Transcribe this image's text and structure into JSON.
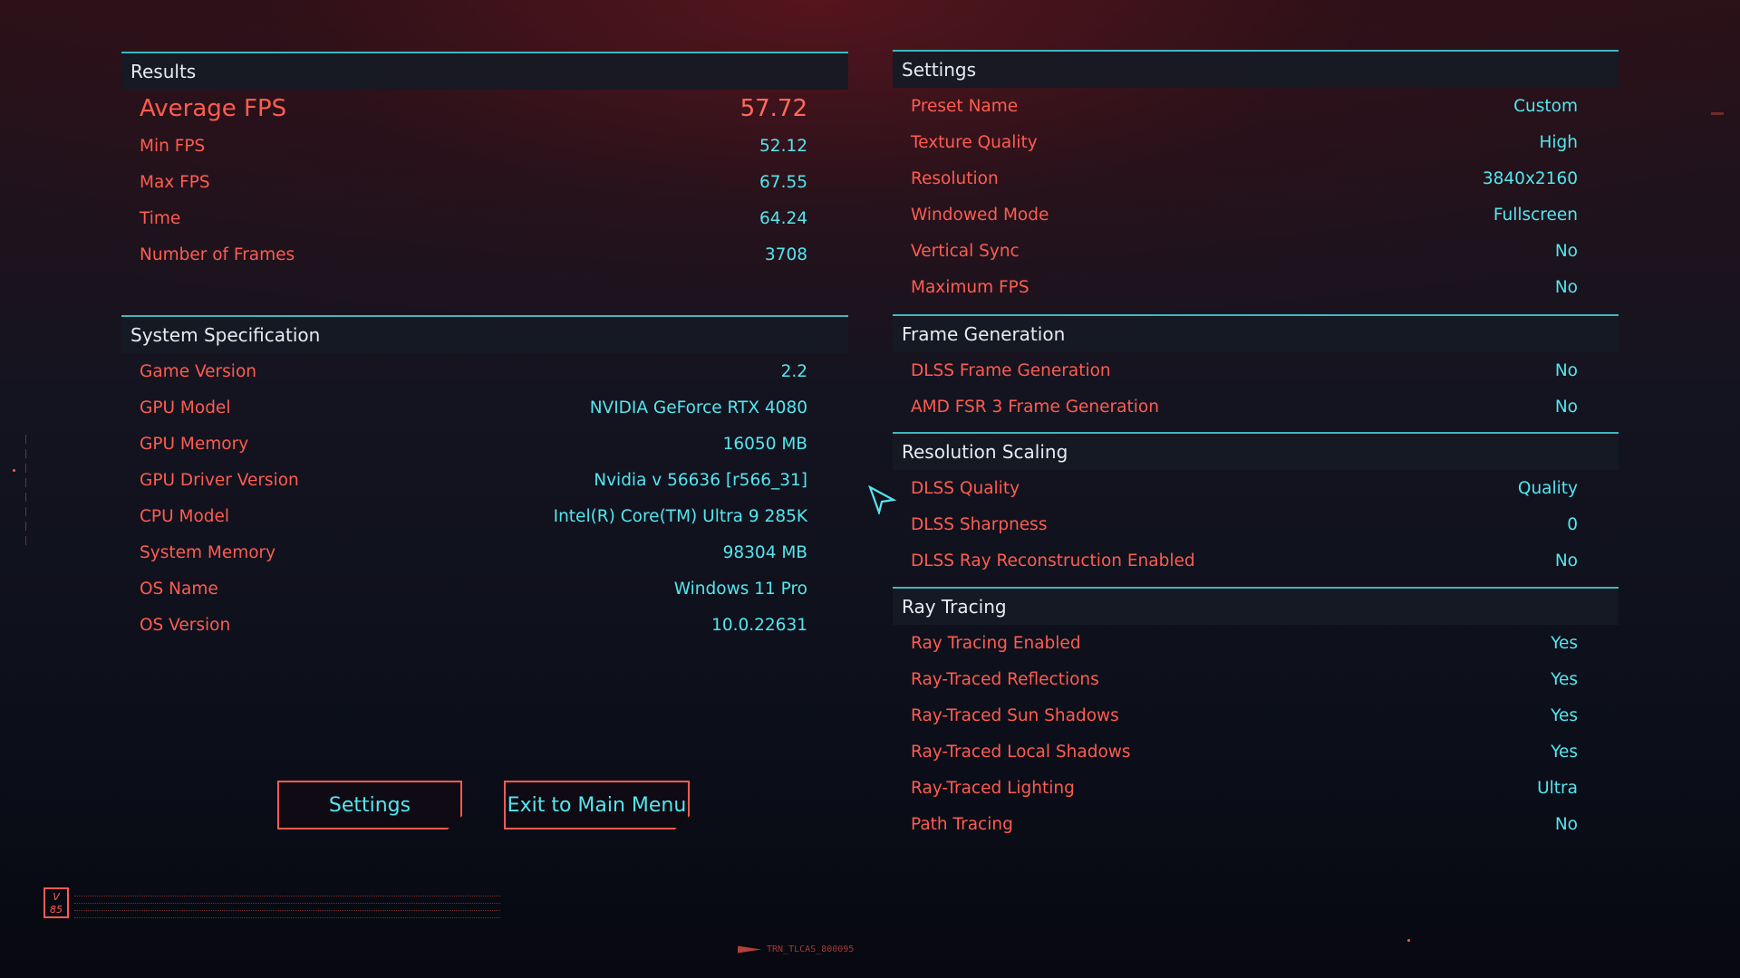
{
  "colors": {
    "label": "#ff5c50",
    "value": "#54e6ee",
    "header_text": "#e6ecf0",
    "accent_line": "#3fb7c0"
  },
  "results": {
    "header": "Results",
    "average_fps": {
      "label": "Average FPS",
      "value": "57.72"
    },
    "rows": [
      {
        "label": "Min FPS",
        "value": "52.12"
      },
      {
        "label": "Max FPS",
        "value": "67.55"
      },
      {
        "label": "Time",
        "value": "64.24"
      },
      {
        "label": "Number of Frames",
        "value": "3708"
      }
    ]
  },
  "system_spec": {
    "header": "System Specification",
    "rows": [
      {
        "label": "Game Version",
        "value": "2.2"
      },
      {
        "label": "GPU Model",
        "value": "NVIDIA GeForce RTX 4080"
      },
      {
        "label": "GPU Memory",
        "value": "16050 MB"
      },
      {
        "label": "GPU Driver Version",
        "value": "Nvidia v 56636 [r566_31]"
      },
      {
        "label": "CPU Model",
        "value": "Intel(R) Core(TM) Ultra 9 285K"
      },
      {
        "label": "System Memory",
        "value": "98304 MB"
      },
      {
        "label": "OS Name",
        "value": "Windows 11 Pro"
      },
      {
        "label": "OS Version",
        "value": "10.0.22631"
      }
    ]
  },
  "settings": {
    "header": "Settings",
    "rows": [
      {
        "label": "Preset Name",
        "value": "Custom"
      },
      {
        "label": "Texture Quality",
        "value": "High"
      },
      {
        "label": "Resolution",
        "value": "3840x2160"
      },
      {
        "label": "Windowed Mode",
        "value": "Fullscreen"
      },
      {
        "label": "Vertical Sync",
        "value": "No"
      },
      {
        "label": "Maximum FPS",
        "value": "No"
      }
    ]
  },
  "frame_generation": {
    "header": "Frame Generation",
    "rows": [
      {
        "label": "DLSS Frame Generation",
        "value": "No"
      },
      {
        "label": "AMD FSR 3 Frame Generation",
        "value": "No"
      }
    ]
  },
  "resolution_scaling": {
    "header": "Resolution Scaling",
    "rows": [
      {
        "label": "DLSS Quality",
        "value": "Quality"
      },
      {
        "label": "DLSS Sharpness",
        "value": "0"
      },
      {
        "label": "DLSS Ray Reconstruction Enabled",
        "value": "No"
      }
    ]
  },
  "ray_tracing": {
    "header": "Ray Tracing",
    "rows": [
      {
        "label": "Ray Tracing Enabled",
        "value": "Yes"
      },
      {
        "label": "Ray-Traced Reflections",
        "value": "Yes"
      },
      {
        "label": "Ray-Traced Sun Shadows",
        "value": "Yes"
      },
      {
        "label": "Ray-Traced Local Shadows",
        "value": "Yes"
      },
      {
        "label": "Ray-Traced Lighting",
        "value": "Ultra"
      },
      {
        "label": "Path Tracing",
        "value": "No"
      }
    ]
  },
  "buttons": {
    "settings": "Settings",
    "exit": "Exit to Main Menu"
  },
  "footer": {
    "logo_text": "V 85",
    "build_code": "TRN_TLCAS_800095"
  }
}
